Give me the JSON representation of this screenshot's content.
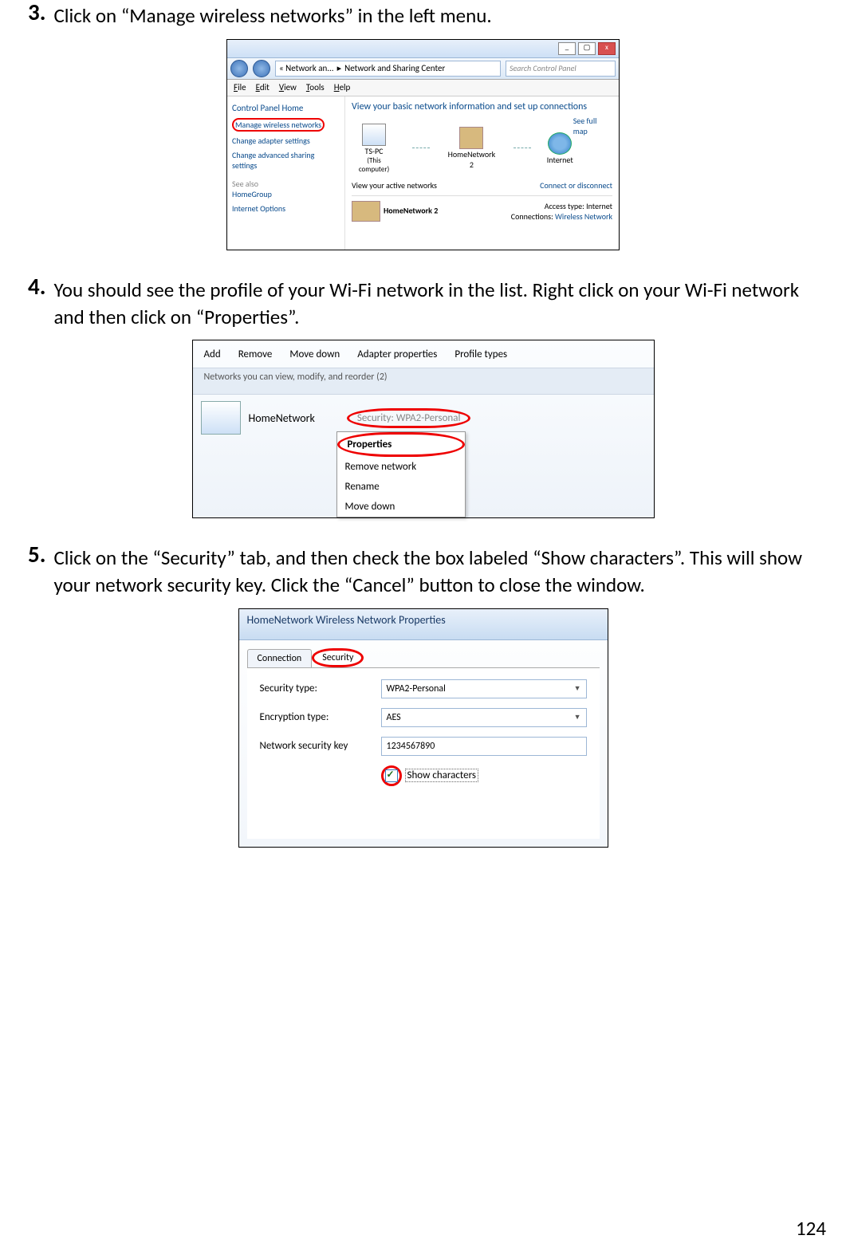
{
  "steps": {
    "s3": {
      "num": "3.",
      "text": "Click on “Manage wireless networks” in the left menu."
    },
    "s4": {
      "num": "4.",
      "text": "You should see the profile of your Wi-Fi network in the list. Right click on your Wi-Fi network and then click on “Properties”."
    },
    "s5": {
      "num": "5.",
      "text": "Click on the “Security” tab, and then check the box labeled “Show characters”. This will show your network security key. Click the “Cancel” button to close the window."
    }
  },
  "page_number": "124",
  "fig1": {
    "crumbs": {
      "a": "« Network an...",
      "sep": "▸",
      "b": "Network and Sharing Center"
    },
    "search_placeholder": "Search Control Panel",
    "menus": {
      "file": "File",
      "edit": "Edit",
      "view": "View",
      "tools": "Tools",
      "help": "Help"
    },
    "left": {
      "home": "Control Panel Home",
      "manage": "Manage wireless networks",
      "adapter": "Change adapter settings",
      "advanced": "Change advanced sharing settings",
      "seealso": "See also",
      "homegroup": "HomeGroup",
      "internet": "Internet Options"
    },
    "right": {
      "title": "View your basic network information and set up connections",
      "fullmap": "See full map",
      "nodes": {
        "pc": "TS-PC",
        "pc_sub": "(This computer)",
        "net": "HomeNetwork 2",
        "internet": "Internet"
      },
      "active_hdr": "View your active networks",
      "connect": "Connect or disconnect",
      "net_name": "HomeNetwork 2",
      "access": "Access type:",
      "access_val": "Internet",
      "conn": "Connections:",
      "conn_val": "Wireless Network"
    }
  },
  "fig2": {
    "toolbar": {
      "add": "Add",
      "remove": "Remove",
      "movedown": "Move down",
      "adapter": "Adapter properties",
      "profile": "Profile types"
    },
    "subhdr": "Networks you can view, modify, and reorder (2)",
    "network": "HomeNetwork",
    "security": "Security: WPA2-Personal",
    "ctx": {
      "prop": "Properties",
      "remove": "Remove network",
      "rename": "Rename",
      "movedown": "Move down"
    }
  },
  "fig3": {
    "title": "HomeNetwork Wireless Network Properties",
    "tabs": {
      "connection": "Connection",
      "security": "Security"
    },
    "labels": {
      "sectype": "Security type:",
      "enctype": "Encryption type:",
      "key": "Network security key"
    },
    "values": {
      "sectype": "WPA2-Personal",
      "enctype": "AES",
      "key": "1234567890"
    },
    "showchars": "Show characters"
  }
}
